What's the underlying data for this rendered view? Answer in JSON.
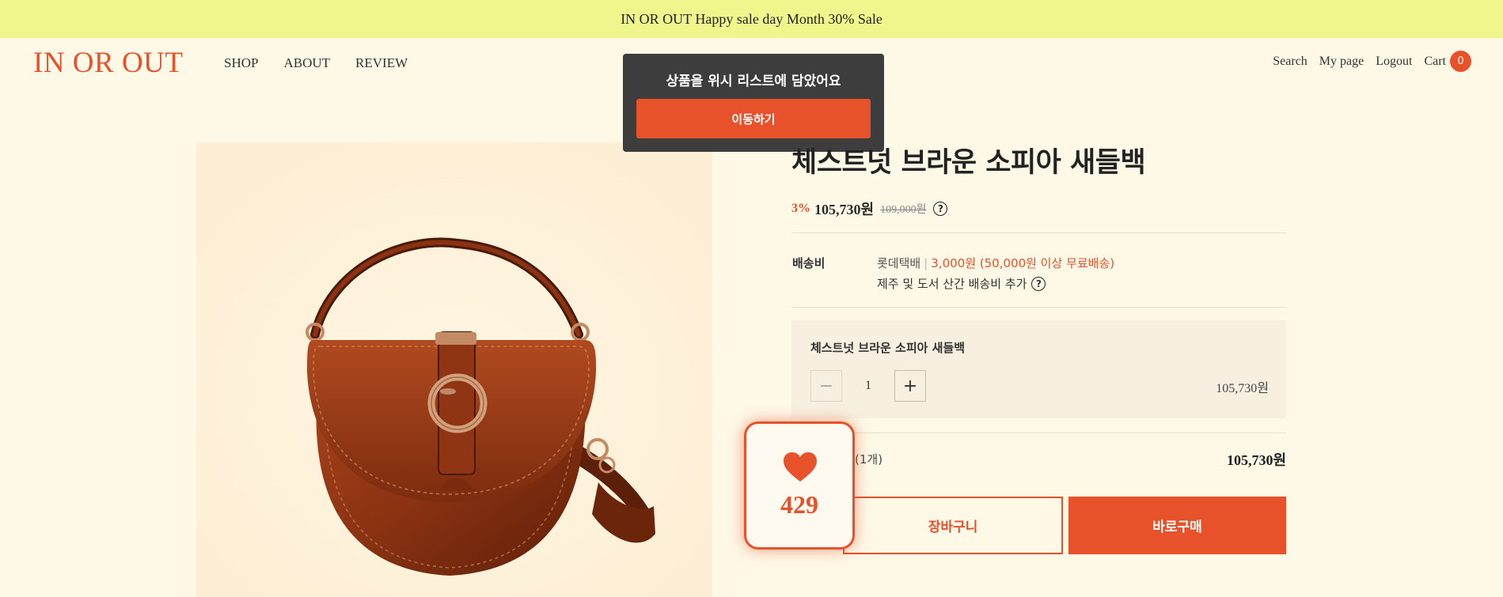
{
  "announcement": {
    "text": "IN OR OUT Happy sale day Month 30% Sale"
  },
  "header": {
    "logo": "IN OR OUT",
    "nav": [
      "SHOP",
      "ABOUT",
      "REVIEW"
    ],
    "user_nav": {
      "search": "Search",
      "mypage": "My page",
      "logout": "Logout",
      "cart": "Cart",
      "cart_count": "0"
    }
  },
  "toast": {
    "message": "상품을 위시 리스트에 담았어요",
    "button": "이동하기"
  },
  "product": {
    "title": "체스트넛 브라운 소피아 새들백",
    "discount": "3%",
    "price": "105,730원",
    "original_price": "109,000원",
    "help_icon": "question-circle-icon"
  },
  "shipping": {
    "label": "배송비",
    "carrier": "롯데택배",
    "separator": "|",
    "fee": "3,000원 (50,000원 이상 무료배송)",
    "extra": "제주 및 도서 산간 배송비 추가"
  },
  "option": {
    "name": "체스트넛 브라운 소피아 새들백",
    "quantity": "1",
    "minus": "−",
    "plus": "+",
    "price": "105,730원"
  },
  "total": {
    "count_label": "(1개)",
    "price": "105,730원"
  },
  "actions": {
    "cart": "장바구니",
    "buy": "바로구매"
  },
  "wishlist": {
    "count": "429"
  },
  "colors": {
    "accent": "#e8522a",
    "banner": "#f0f58c",
    "background": "#fef8e7",
    "toast": "#3c3d3c"
  }
}
